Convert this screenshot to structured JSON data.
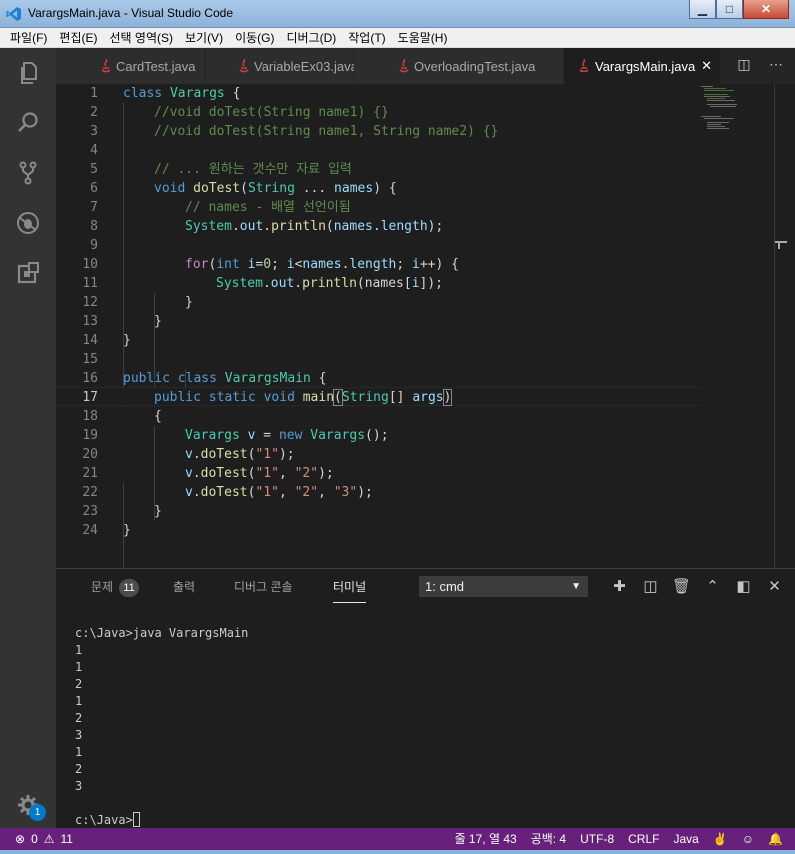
{
  "window": {
    "title": "VarargsMain.java - Visual Studio Code"
  },
  "menu": [
    "파일(F)",
    "편집(E)",
    "선택 영역(S)",
    "보기(V)",
    "이동(G)",
    "디버그(D)",
    "작업(T)",
    "도움말(H)"
  ],
  "activity": {
    "settings_badge": "1"
  },
  "tabs": [
    {
      "label": "CardTest.java"
    },
    {
      "label": "VariableEx03.java"
    },
    {
      "label": "OverloadingTest.java"
    },
    {
      "label": "VarargsMain.java",
      "active": true
    }
  ],
  "editor": {
    "current_line": 17,
    "lines": [
      "1",
      "2",
      "3",
      "4",
      "5",
      "6",
      "7",
      "8",
      "9",
      "10",
      "11",
      "12",
      "13",
      "14",
      "15",
      "16",
      "17",
      "18",
      "19",
      "20",
      "21",
      "22",
      "23",
      "24"
    ],
    "code": {
      "l1": [
        "class",
        " ",
        "Varargs",
        " {"
      ],
      "l2": "//void doTest(String name1) {}",
      "l3": "//void doTest(String name1, String name2) {}",
      "l5": "// ... 원하는 갯수만 자료 입력",
      "l6": [
        "void",
        " ",
        "doTest",
        "(",
        "String",
        " ... ",
        "names",
        ") {"
      ],
      "l7": "// names - 배열 선언이됨",
      "l8": [
        "System",
        ".",
        "out",
        ".",
        "println",
        "(",
        "names",
        ".",
        "length",
        ");"
      ],
      "l10": [
        "for",
        "(",
        "int",
        " ",
        "i",
        "=",
        "0",
        "; ",
        "i",
        "<",
        "names",
        ".",
        "length",
        "; ",
        "i",
        "++) {"
      ],
      "l11": [
        "System",
        ".",
        "out",
        ".",
        "println",
        "(names[",
        "i",
        "]);"
      ],
      "l12": "}",
      "l13": "}",
      "l14": "}",
      "l16": [
        "public",
        " ",
        "class",
        " ",
        "VarargsMain",
        " {"
      ],
      "l17": [
        "public",
        " ",
        "static",
        " ",
        "void",
        " ",
        "main",
        "(",
        "String",
        "[] ",
        "args",
        ")"
      ],
      "l18": "{",
      "l19": [
        "Varargs",
        " ",
        "v",
        " = ",
        "new",
        " ",
        "Varargs",
        "();"
      ],
      "l20": [
        "v",
        ".",
        "doTest",
        "(",
        "\"1\"",
        ");"
      ],
      "l21": [
        "v",
        ".",
        "doTest",
        "(",
        "\"1\"",
        ", ",
        "\"2\"",
        ");"
      ],
      "l22": [
        "v",
        ".",
        "doTest",
        "(",
        "\"1\"",
        ", ",
        "\"2\"",
        ", ",
        "\"3\"",
        ");"
      ],
      "l23": "}",
      "l24": "}"
    }
  },
  "panel": {
    "tabs": {
      "problems": "문제",
      "problems_count": "11",
      "output": "출력",
      "debug_console": "디버그 콘솔",
      "terminal": "터미널"
    },
    "terminal_select": "1: cmd",
    "terminal_lines": [
      "c:\\Java>java VarargsMain",
      "1",
      "1",
      "2",
      "1",
      "2",
      "3",
      "1",
      "2",
      "3",
      "",
      "c:\\Java>"
    ]
  },
  "status": {
    "errors": "0",
    "warnings": "11",
    "position": "줄 17, 열 43",
    "indent": "공백: 4",
    "encoding": "UTF-8",
    "eol": "CRLF",
    "language": "Java"
  },
  "colors": {
    "statusbar": "#68217a",
    "activitybar": "#333333",
    "editor_bg": "#1e1e1e"
  }
}
